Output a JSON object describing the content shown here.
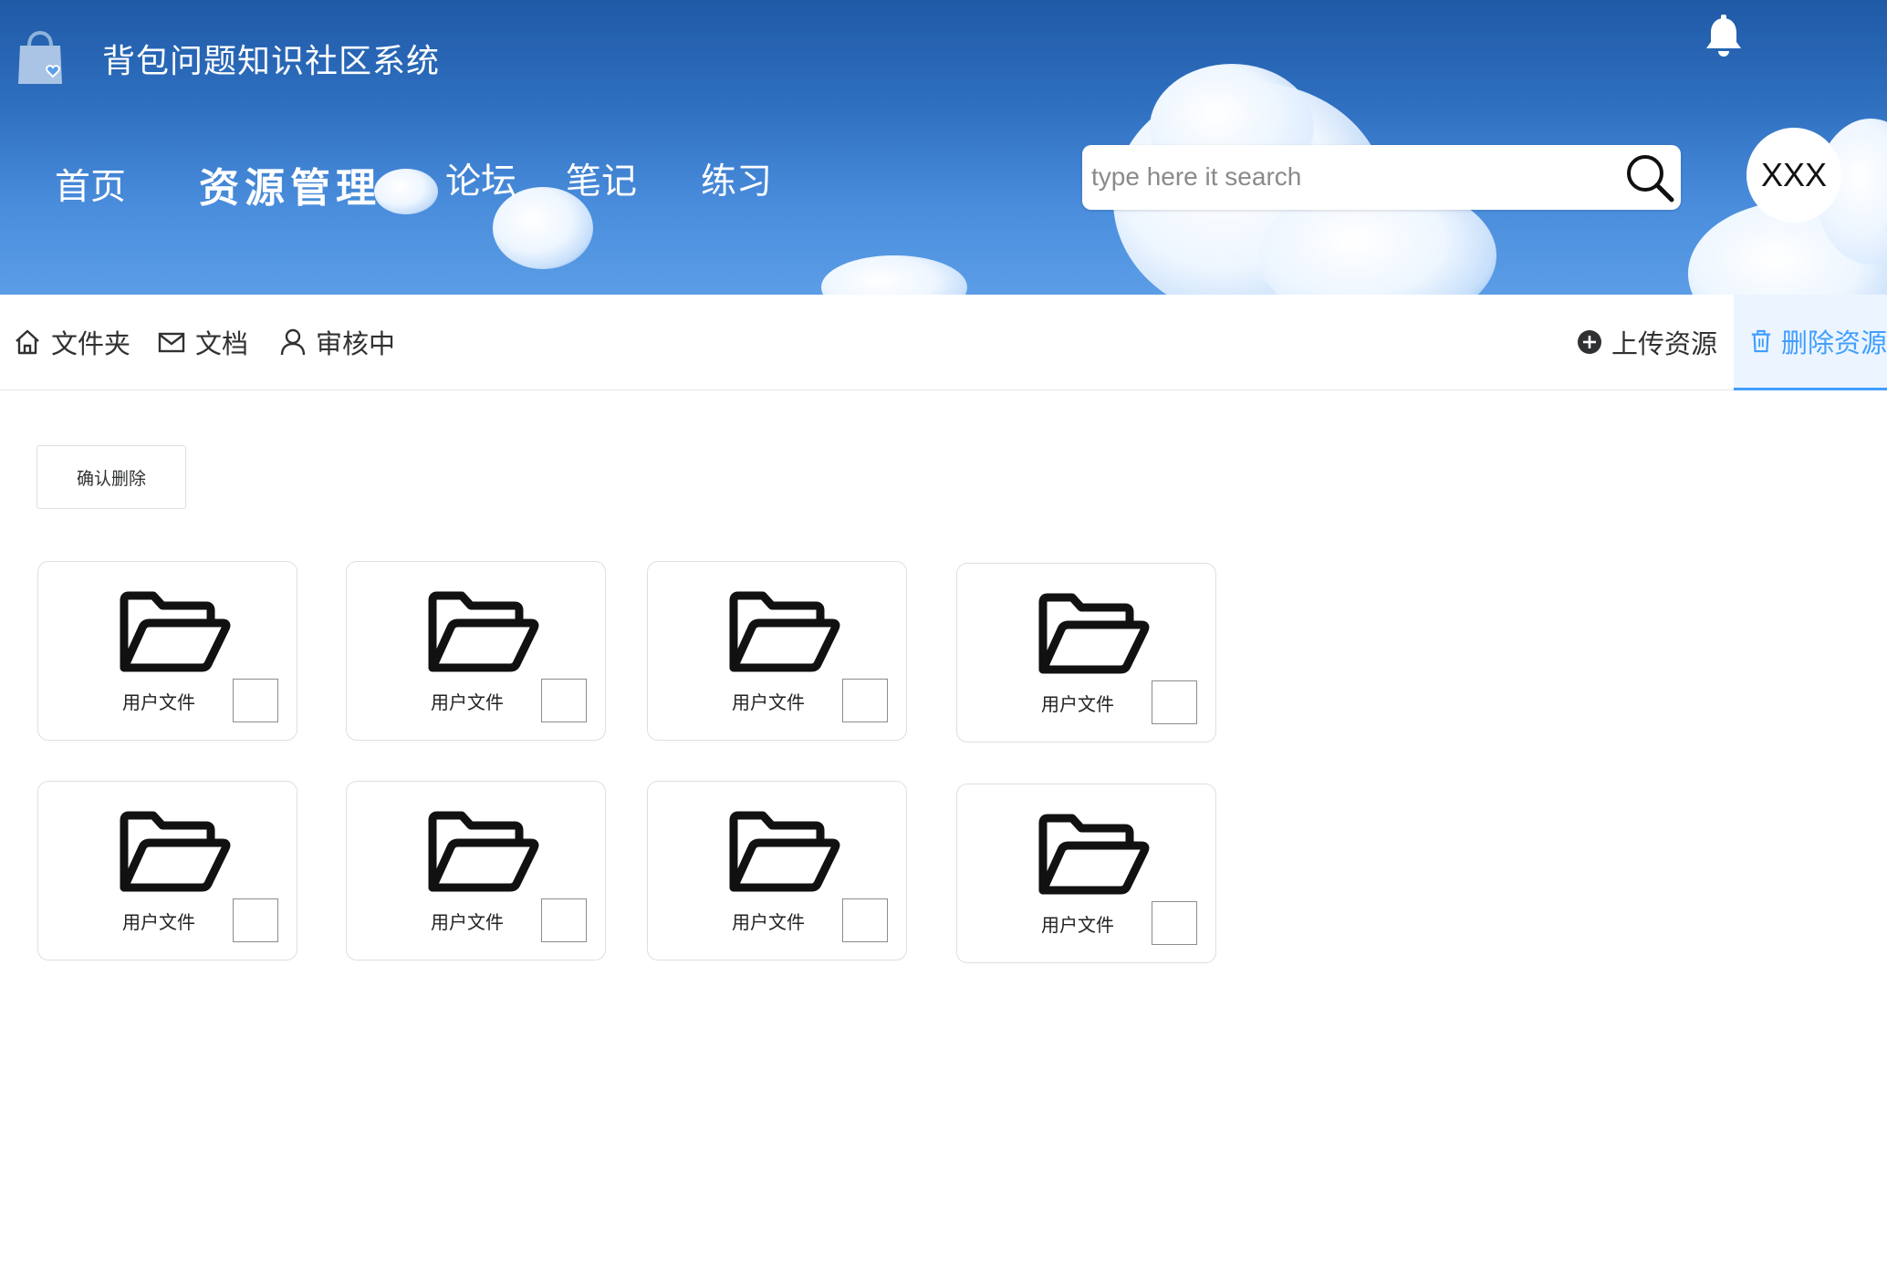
{
  "header": {
    "site_title": "背包问题知识社区系统",
    "nav": [
      "首页",
      "资源管理",
      "论坛",
      "笔记",
      "练习"
    ],
    "search_placeholder": "type here it search",
    "avatar_text": "XXX",
    "icons": {
      "logo": "shopping-bag-heart-icon",
      "notification": "bell-icon",
      "search": "magnifier-icon"
    }
  },
  "submenu": {
    "items": [
      {
        "label": "文件夹",
        "icon": "home-icon"
      },
      {
        "label": "文档",
        "icon": "mail-icon"
      },
      {
        "label": "审核中",
        "icon": "user-icon"
      },
      {
        "label": "上传资源",
        "icon": "plus-circle-icon"
      },
      {
        "label": "删除资源",
        "icon": "trash-icon",
        "active": true
      }
    ]
  },
  "content": {
    "confirm_delete_label": "确认删除",
    "folders": [
      {
        "label": "用户文件",
        "checked": false
      },
      {
        "label": "用户文件",
        "checked": false
      },
      {
        "label": "用户文件",
        "checked": false
      },
      {
        "label": "用户文件",
        "checked": false
      },
      {
        "label": "用户文件",
        "checked": false
      },
      {
        "label": "用户文件",
        "checked": false
      },
      {
        "label": "用户文件",
        "checked": false
      },
      {
        "label": "用户文件",
        "checked": false
      }
    ],
    "folder_icon": "folder-open-icon"
  },
  "colors": {
    "header_blue": "#2f6fc0",
    "active_menu_bg": "#ecf5ff",
    "active_menu_text": "#409eff",
    "border": "#dcdfe6"
  }
}
